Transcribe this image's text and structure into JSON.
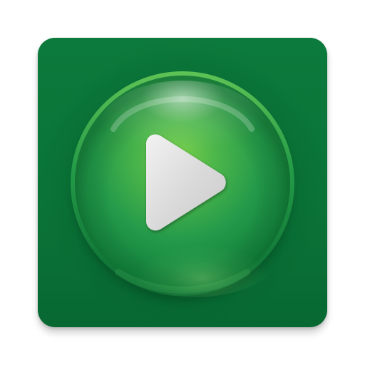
{
  "app": {
    "icon_name": "play-icon",
    "colors": {
      "tile": "#0a7438",
      "tile_shadow": "#065a2a",
      "button_light": "#7bd44a",
      "button_mid": "#33a94a",
      "button_dark": "#0f7a37",
      "button_rim": "#0c6f33",
      "play_glyph": "#e7e7e7"
    }
  }
}
